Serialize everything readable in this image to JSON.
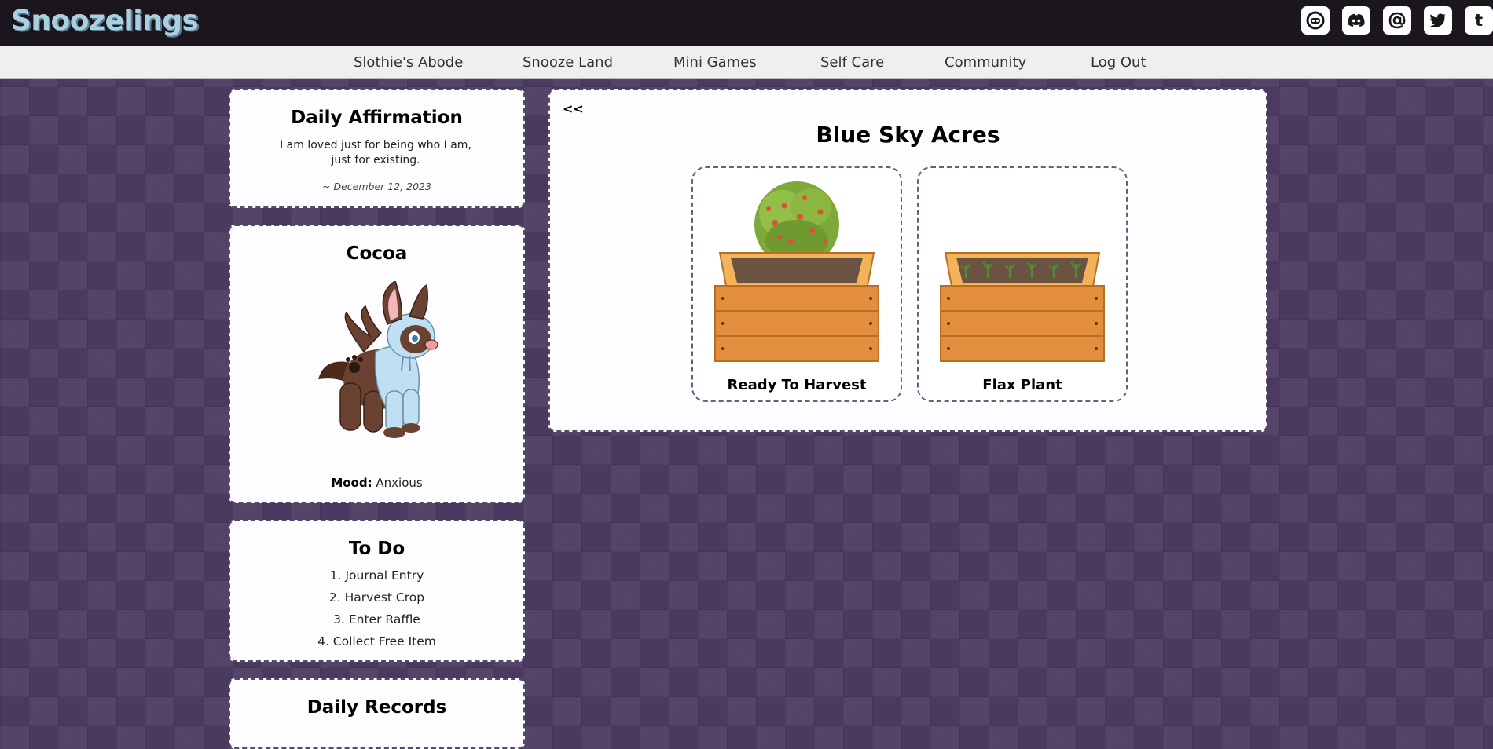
{
  "app": {
    "logo": "Snoozelings"
  },
  "social": [
    {
      "name": "cohost-icon"
    },
    {
      "name": "discord-icon"
    },
    {
      "name": "threads-icon"
    },
    {
      "name": "twitter-icon"
    },
    {
      "name": "tumblr-icon",
      "glyph": "t"
    }
  ],
  "nav": {
    "items": [
      "Slothie's Abode",
      "Snooze Land",
      "Mini Games",
      "Self Care",
      "Community",
      "Log Out"
    ]
  },
  "affirmation": {
    "title": "Daily Affirmation",
    "text": "I am loved just for being who I am, just for existing.",
    "date": "~ December 12, 2023"
  },
  "pet": {
    "name": "Cocoa",
    "mood_label": "Mood:",
    "mood_value": "Anxious"
  },
  "todo": {
    "title": "To Do",
    "items": [
      "1. Journal Entry",
      "2. Harvest Crop",
      "3. Enter Raffle",
      "4. Collect Free Item"
    ]
  },
  "records": {
    "title": "Daily Records"
  },
  "farm": {
    "back": "<<",
    "title": "Blue Sky Acres",
    "plots": [
      {
        "label": "Ready To Harvest"
      },
      {
        "label": "Flax Plant"
      }
    ]
  },
  "colors": {
    "topbar": "#1b161d",
    "logo": "#a9cfe0",
    "background": "#4a3a60",
    "panel_border": "#57496c"
  }
}
